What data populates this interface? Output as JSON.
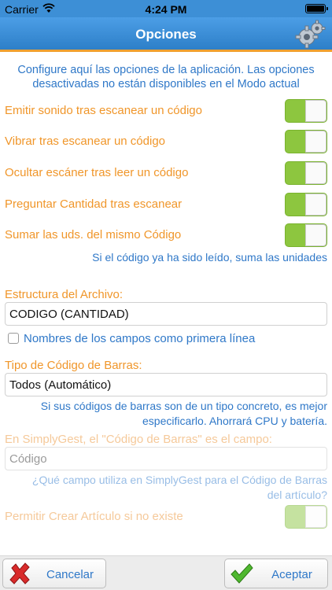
{
  "status_bar": {
    "carrier": "Carrier",
    "time": "4:24 PM"
  },
  "nav": {
    "title": "Opciones",
    "icon": "gears-icon"
  },
  "intro": "Configure aquí las opciones de la aplicación. Las opciones desactivadas no están disponibles en el Modo actual",
  "toggles": [
    {
      "label": "Emitir sonido tras escanear un código",
      "on": true
    },
    {
      "label": "Vibrar tras escanear un código",
      "on": true
    },
    {
      "label": "Ocultar escáner tras leer un código",
      "on": true
    },
    {
      "label": "Preguntar Cantidad tras escanear",
      "on": true
    },
    {
      "label": "Sumar las uds. del mismo Código",
      "on": true
    }
  ],
  "sum_hint": "Si el código ya ha sido leído, suma las unidades",
  "file_structure": {
    "label": "Estructura del Archivo:",
    "value": "CODIGO (CANTIDAD)"
  },
  "field_names_checkbox": {
    "label": "Nombres de los campos como primera línea",
    "checked": false
  },
  "barcode_type": {
    "label": "Tipo de Código de Barras:",
    "value": "Todos (Automático)",
    "hint_line1": "Si sus códigos de barras son de un tipo concreto, es mejor",
    "hint_line2": "especificarlo. Ahorrará CPU y batería."
  },
  "simplygest_field": {
    "label": "En SimplyGest, el \"Código de Barras\" es el campo:",
    "placeholder": "Código",
    "hint_line1": "¿Qué campo utiliza en SimplyGest para el Código de Barras",
    "hint_line2": "del artículo?"
  },
  "create_article": {
    "label": "Permitir Crear Artículo si no existe",
    "on": true,
    "enabled": false
  },
  "buttons": {
    "cancel": "Cancelar",
    "accept": "Aceptar"
  },
  "colors": {
    "accent_blue": "#2f78c8",
    "label_orange": "#f0962a",
    "toggle_green": "#8dc63f",
    "nav_blue": "#3d8fd6"
  }
}
